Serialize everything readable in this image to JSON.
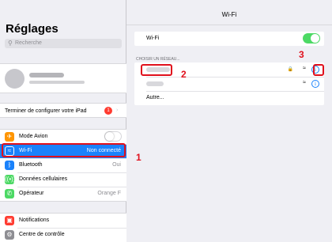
{
  "left": {
    "title": "Réglages",
    "search_placeholder": "Recherche",
    "setup_label": "Terminer de configurer votre iPad",
    "setup_badge": "1",
    "group1": [
      {
        "label": "Mode Avion",
        "icon": "airplane-icon",
        "color": "#ff9500",
        "value": ""
      },
      {
        "label": "Wi-Fi",
        "icon": "wifi-icon",
        "color": "#1a82fb",
        "value": "Non connecté"
      },
      {
        "label": "Bluetooth",
        "icon": "bluetooth-icon",
        "color": "#1a82fb",
        "value": "Oui"
      },
      {
        "label": "Données cellulaires",
        "icon": "cellular-icon",
        "color": "#4cd964",
        "value": ""
      },
      {
        "label": "Opérateur",
        "icon": "phone-icon",
        "color": "#4cd964",
        "value": "Orange F"
      }
    ],
    "group2": [
      {
        "label": "Notifications",
        "icon": "notifications-icon",
        "color": "#ff3b30"
      },
      {
        "label": "Centre de contrôle",
        "icon": "control-center-icon",
        "color": "#8e8e93"
      }
    ]
  },
  "right": {
    "nav_title": "Wi-Fi",
    "wifi_label": "Wi-Fi",
    "section_label": "CHOISIR UN RÉSEAU...",
    "other_label": "Autre..."
  },
  "annotations": {
    "one": "1",
    "two": "2",
    "three": "3"
  },
  "colors": {
    "accent": "#1a82fb",
    "highlight": "#e0101c",
    "toggle_on": "#4cd964"
  }
}
